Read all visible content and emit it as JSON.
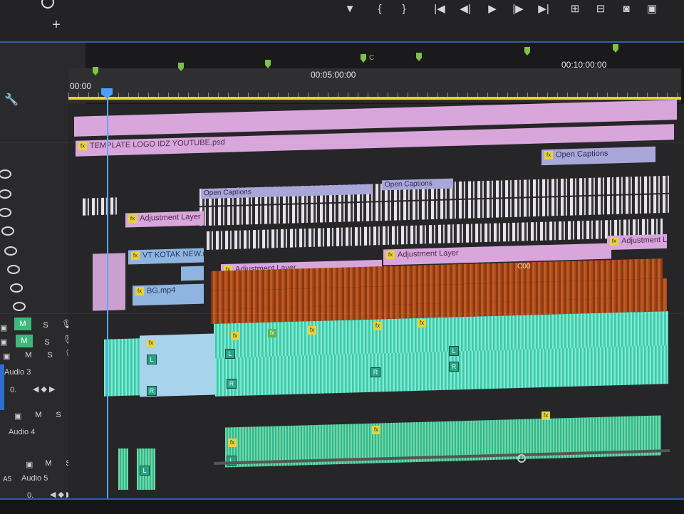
{
  "ruler": {
    "timecodes": [
      "00:00",
      "00:05:00:00",
      "00:10:00:00"
    ],
    "marker_label": "C"
  },
  "tracks": {
    "audio3": {
      "m": "M",
      "s": "S",
      "name": "Audio 3",
      "value": "0."
    },
    "audio4": {
      "m": "M",
      "s": "S",
      "name": "Audio 4",
      "id": "A4"
    },
    "audio5": {
      "m": "M",
      "s": "S",
      "name": "Audio 5",
      "id": "A5",
      "value": "0."
    },
    "v_m1": "M",
    "v_s1": "S",
    "v_m2": "M",
    "v_s2": "S"
  },
  "clips": {
    "template_logo": "TEMPLATE LOGO  IDZ YOUTUBE.psd",
    "open_captions_1": "Open Captions",
    "open_captions_2": "Open Captions",
    "open_captions_3": "Open Captions",
    "adjustment_1": "Adjustment Layer",
    "adjustment_2": "Adjustment Layer",
    "adjustment_3": "Adjustment Layer",
    "adjustment_4": "Adjustment Lay",
    "vt_kotak": "VT KOTAK NEW.n",
    "bg_mp4": "BG.mp4",
    "coo": "C00",
    "fx": "fx",
    "L": "L",
    "R": "R"
  },
  "icons": [
    "plus-icon",
    "wrench-icon",
    "eye-icon",
    "camera-icon",
    "microphone-icon",
    "play-icon",
    "step-back-icon",
    "step-forward-icon",
    "marker-icon",
    "go-to-in-icon",
    "go-to-out-icon",
    "lift-icon",
    "extract-icon",
    "export-frame-icon"
  ]
}
